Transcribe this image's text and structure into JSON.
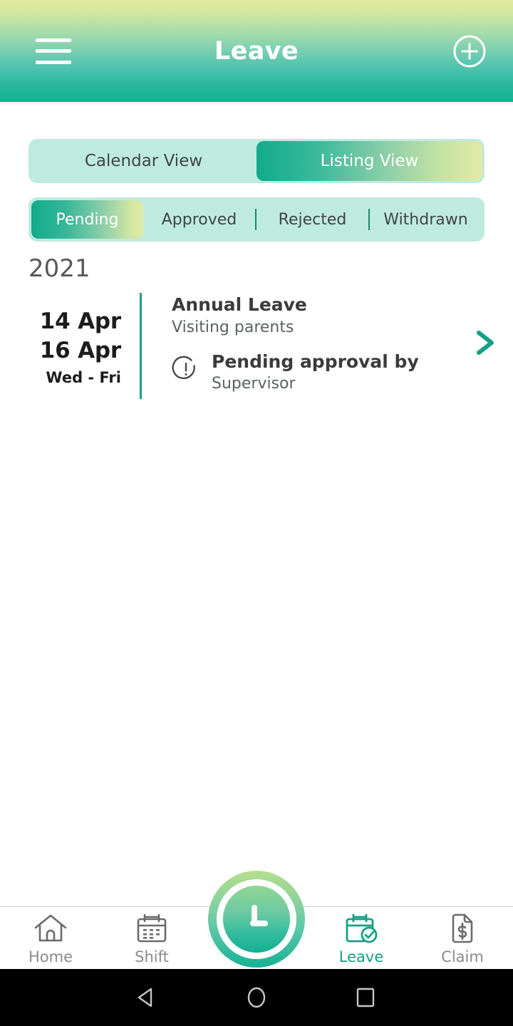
{
  "header": {
    "title": "Leave",
    "menu_icon": "hamburger-menu-icon",
    "add_icon": "plus-circle-icon"
  },
  "view_toggle": {
    "options": [
      {
        "label": "Calendar View",
        "active": false
      },
      {
        "label": "Listing View",
        "active": true
      }
    ]
  },
  "status_tabs": {
    "options": [
      {
        "label": "Pending",
        "active": true
      },
      {
        "label": "Approved",
        "active": false
      },
      {
        "label": "Rejected",
        "active": false
      },
      {
        "label": "Withdrawn",
        "active": false
      }
    ]
  },
  "list": {
    "year": "2021",
    "items": [
      {
        "start_date": "14 Apr",
        "end_date": "16 Apr",
        "day_range": "Wed - Fri",
        "leave_type": "Annual Leave",
        "reason": "Visiting parents",
        "status_title": "Pending approval by",
        "status_subject": "Supervisor",
        "status_icon": "exclamation-circle-icon",
        "chevron_icon": "chevron-right-icon"
      }
    ]
  },
  "bottom_nav": {
    "items": [
      {
        "label": "Home",
        "icon": "home-icon",
        "active": false
      },
      {
        "label": "Shift",
        "icon": "calendar-icon",
        "active": false
      },
      {
        "label": "Leave",
        "icon": "calendar-check-icon",
        "active": true
      },
      {
        "label": "Claim",
        "icon": "document-dollar-icon",
        "active": false
      }
    ],
    "fab": {
      "icon": "clock-icon"
    }
  },
  "android_nav": {
    "back": "back-triangle-icon",
    "home": "home-circle-icon",
    "recents": "recents-square-icon"
  },
  "colors": {
    "teal": "#16a085",
    "gradient_start": "#10ab8c",
    "gradient_end": "#e2eaa5",
    "track": "#bfeae0",
    "inactive_text": "#8b8b8b"
  }
}
